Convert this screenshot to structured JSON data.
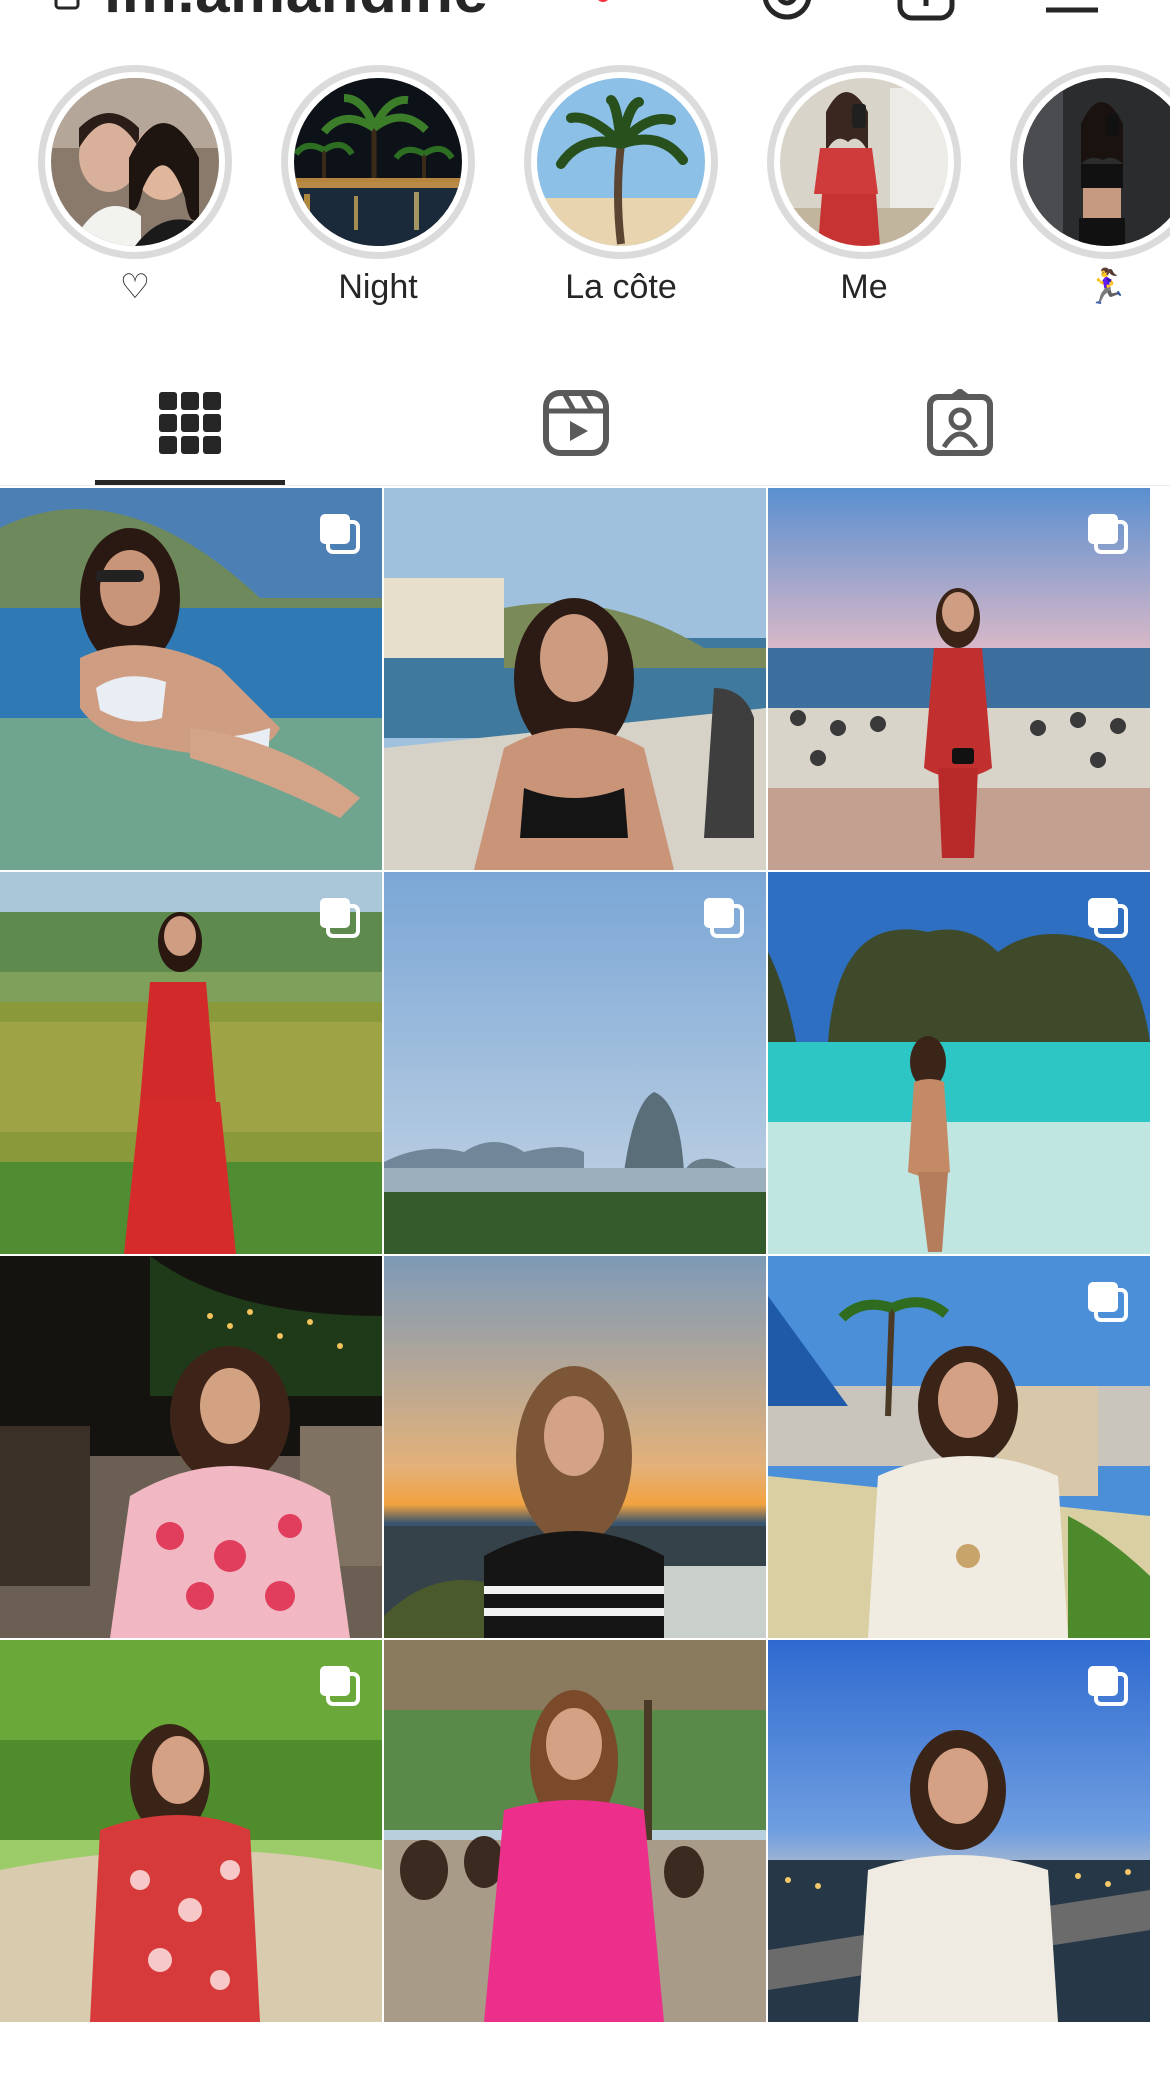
{
  "profile": {
    "username": "lm.amandine",
    "has_notification": true
  },
  "header": {
    "icons": [
      "lock-icon",
      "threads-icon",
      "add-post-icon",
      "menu-icon"
    ]
  },
  "highlights": [
    {
      "label": "♡",
      "cover": "couple-selfie"
    },
    {
      "label": "Night",
      "cover": "night-harbor"
    },
    {
      "label": "La côte",
      "cover": "palm-tree"
    },
    {
      "label": "Me",
      "cover": "mirror-selfie-red"
    },
    {
      "label": "🏃‍♀️",
      "cover": "gym-mirror-selfie"
    }
  ],
  "tabs": [
    {
      "name": "posts",
      "icon": "grid-icon",
      "active": true
    },
    {
      "name": "reels",
      "icon": "reels-icon",
      "active": false
    },
    {
      "name": "tagged",
      "icon": "tagged-icon",
      "active": false
    }
  ],
  "posts": [
    {
      "scene": "woman in white bikini on beach towel",
      "multiple": true
    },
    {
      "scene": "woman at seaside terrace table",
      "multiple": false
    },
    {
      "scene": "woman in red dress by beach umbrellas",
      "multiple": true
    },
    {
      "scene": "woman in red gown by lake",
      "multiple": true
    },
    {
      "scene": "misty bay with karst islands",
      "multiple": true
    },
    {
      "scene": "woman in turquoise lagoon with cliffs",
      "multiple": true
    },
    {
      "scene": "woman in floral dress at night lounge",
      "multiple": false
    },
    {
      "scene": "woman in striped sweater at sunset",
      "multiple": false
    },
    {
      "scene": "woman in white knit dress on balcony",
      "multiple": true
    },
    {
      "scene": "woman in floral dress in garden",
      "multiple": true
    },
    {
      "scene": "woman in pink dress under pergola",
      "multiple": false
    },
    {
      "scene": "woman in white dress at dusk cityscape",
      "multiple": true
    }
  ],
  "colors": {
    "text": "#262626",
    "ring": "#dbdbdb",
    "accent_dot": "#ff3040"
  }
}
